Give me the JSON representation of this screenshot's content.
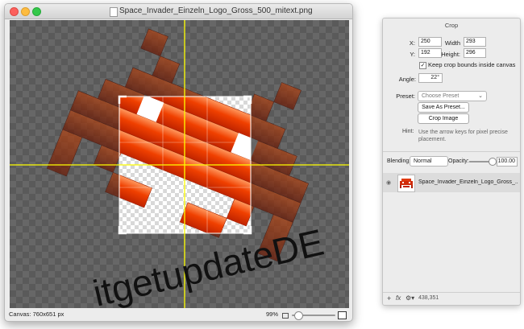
{
  "window": {
    "filename": "Space_Invader_Einzeln_Logo_Gross_500_mitext.png",
    "canvas_info": "Canvas: 760x651 px",
    "zoom": "99%",
    "overlay_text": "itgetupdateDE"
  },
  "crop_panel": {
    "title": "Crop",
    "x_label": "X:",
    "x_value": "250",
    "width_label": "Width",
    "width_value": "293",
    "y_label": "Y:",
    "y_value": "192",
    "height_label": "Height:",
    "height_value": "296",
    "keep_bounds_label": "Keep crop bounds inside canvas",
    "keep_bounds_checked": "✓",
    "angle_label": "Angle:",
    "angle_value": "22°",
    "preset_label": "Preset:",
    "preset_placeholder": "Choose Preset",
    "save_preset_button": "Save As Preset...",
    "crop_image_button": "Crop Image",
    "hint_label": "Hint:",
    "hint_text": "Use the arrow keys for pixel precise placement."
  },
  "layers_panel": {
    "blending_label": "Blending:",
    "blending_value": "Normal",
    "opacity_label": "Opacity:",
    "opacity_value": "100.00",
    "layer_name": "Space_Invader_Einzeln_Logo_Gross_...",
    "footer_info": "438,351"
  },
  "colors": {
    "guide": "#ffff00",
    "annotation_arrow": "#e8201c",
    "invader_dark": "#7a1f08",
    "invader_bright": "#f03a00"
  }
}
